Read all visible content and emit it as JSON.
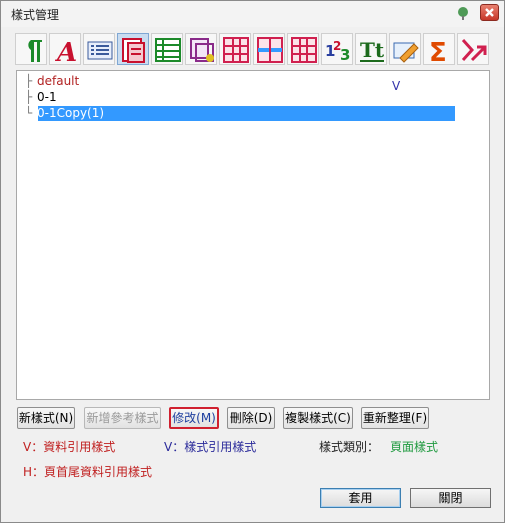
{
  "window": {
    "title": "樣式管理"
  },
  "toolbar": {
    "items": [
      {
        "name": "paragraph"
      },
      {
        "name": "font"
      },
      {
        "name": "list"
      },
      {
        "name": "page"
      },
      {
        "name": "table-lines"
      },
      {
        "name": "frame"
      },
      {
        "name": "table-red"
      },
      {
        "name": "table-grid"
      },
      {
        "name": "table-cols"
      },
      {
        "name": "numbering"
      },
      {
        "name": "text-tt"
      },
      {
        "name": "highlighter"
      },
      {
        "name": "sigma"
      },
      {
        "name": "signal"
      }
    ]
  },
  "tree": {
    "nodes": [
      {
        "label": "default",
        "mark": "V"
      },
      {
        "label": "0-1"
      },
      {
        "label": "0-1Copy(1)"
      }
    ]
  },
  "buttons": {
    "new": "新樣式(N)",
    "add_ref": "新增參考樣式",
    "modify": "修改(M)",
    "delete": "刪除(D)",
    "copy": "複製樣式(C)",
    "reorganize": "重新整理(F)"
  },
  "legend": {
    "v_ref": "V：資料引用樣式",
    "v_style": "V：樣式引用樣式",
    "type_label": "樣式類別：",
    "type_value": "頁面樣式",
    "h_ref": "H：頁首尾資料引用樣式"
  },
  "footer": {
    "apply": "套用",
    "close": "關閉"
  },
  "colors": {
    "red_text": "#c02020",
    "blue_text": "#2a2a9a",
    "green_text": "#1f9a3f",
    "selection": "#3399ff"
  }
}
